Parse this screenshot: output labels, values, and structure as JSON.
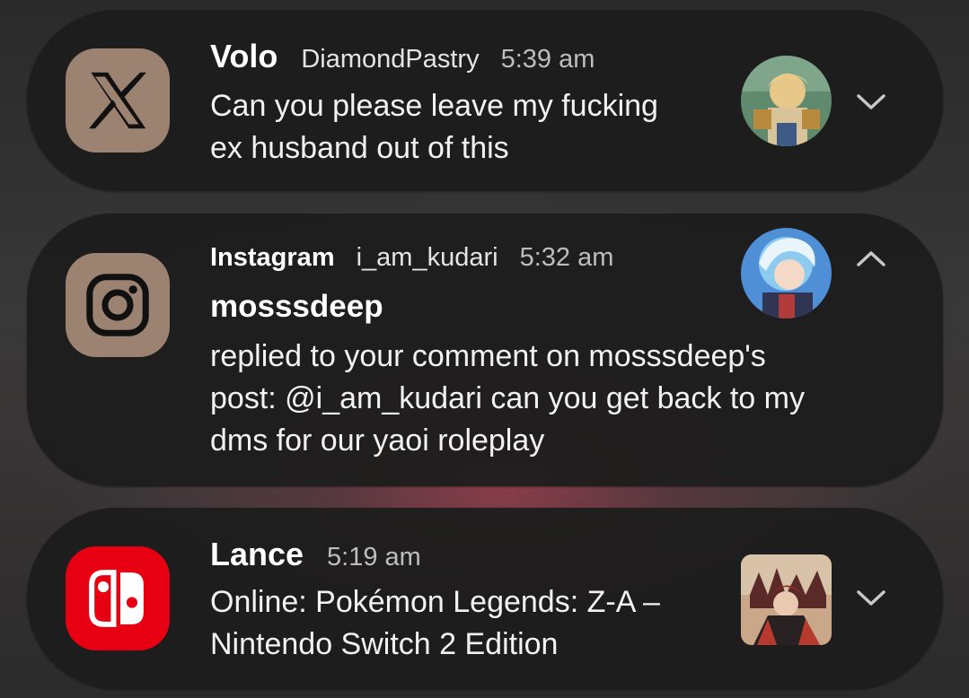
{
  "notifications": [
    {
      "app_icon": "x-twitter-icon",
      "sender": "Volo",
      "subname": "DiamondPastry",
      "time": "5:39 am",
      "body_lines": [
        "Can you please leave my fucking",
        "ex husband out of this"
      ],
      "expand_icon": "chevron-down-icon"
    },
    {
      "app_icon": "instagram-icon",
      "app_name": "Instagram",
      "subname": "i_am_kudari",
      "time": "5:32 am",
      "title": "mosssdeep",
      "body_lines": [
        "replied to your comment on mosssdeep's",
        "post: @i_am_kudari can you get back to my",
        "dms for our yaoi roleplay"
      ],
      "expand_icon": "chevron-up-icon"
    },
    {
      "app_icon": "nintendo-switch-icon",
      "sender": "Lance",
      "time": "5:19 am",
      "body_lines": [
        "Online: Pokémon Legends: Z-A –",
        "Nintendo Switch 2 Edition"
      ],
      "expand_icon": "chevron-down-icon"
    }
  ],
  "colors": {
    "card_background": "#1c1c1c",
    "icon_tan": "#9c8270",
    "switch_red": "#e60012"
  }
}
